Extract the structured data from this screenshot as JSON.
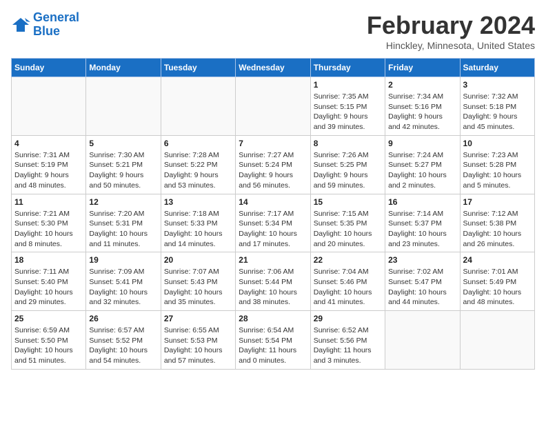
{
  "header": {
    "logo_line1": "General",
    "logo_line2": "Blue",
    "month": "February 2024",
    "location": "Hinckley, Minnesota, United States"
  },
  "weekdays": [
    "Sunday",
    "Monday",
    "Tuesday",
    "Wednesday",
    "Thursday",
    "Friday",
    "Saturday"
  ],
  "weeks": [
    [
      {
        "day": "",
        "info": ""
      },
      {
        "day": "",
        "info": ""
      },
      {
        "day": "",
        "info": ""
      },
      {
        "day": "",
        "info": ""
      },
      {
        "day": "1",
        "info": "Sunrise: 7:35 AM\nSunset: 5:15 PM\nDaylight: 9 hours\nand 39 minutes."
      },
      {
        "day": "2",
        "info": "Sunrise: 7:34 AM\nSunset: 5:16 PM\nDaylight: 9 hours\nand 42 minutes."
      },
      {
        "day": "3",
        "info": "Sunrise: 7:32 AM\nSunset: 5:18 PM\nDaylight: 9 hours\nand 45 minutes."
      }
    ],
    [
      {
        "day": "4",
        "info": "Sunrise: 7:31 AM\nSunset: 5:19 PM\nDaylight: 9 hours\nand 48 minutes."
      },
      {
        "day": "5",
        "info": "Sunrise: 7:30 AM\nSunset: 5:21 PM\nDaylight: 9 hours\nand 50 minutes."
      },
      {
        "day": "6",
        "info": "Sunrise: 7:28 AM\nSunset: 5:22 PM\nDaylight: 9 hours\nand 53 minutes."
      },
      {
        "day": "7",
        "info": "Sunrise: 7:27 AM\nSunset: 5:24 PM\nDaylight: 9 hours\nand 56 minutes."
      },
      {
        "day": "8",
        "info": "Sunrise: 7:26 AM\nSunset: 5:25 PM\nDaylight: 9 hours\nand 59 minutes."
      },
      {
        "day": "9",
        "info": "Sunrise: 7:24 AM\nSunset: 5:27 PM\nDaylight: 10 hours\nand 2 minutes."
      },
      {
        "day": "10",
        "info": "Sunrise: 7:23 AM\nSunset: 5:28 PM\nDaylight: 10 hours\nand 5 minutes."
      }
    ],
    [
      {
        "day": "11",
        "info": "Sunrise: 7:21 AM\nSunset: 5:30 PM\nDaylight: 10 hours\nand 8 minutes."
      },
      {
        "day": "12",
        "info": "Sunrise: 7:20 AM\nSunset: 5:31 PM\nDaylight: 10 hours\nand 11 minutes."
      },
      {
        "day": "13",
        "info": "Sunrise: 7:18 AM\nSunset: 5:33 PM\nDaylight: 10 hours\nand 14 minutes."
      },
      {
        "day": "14",
        "info": "Sunrise: 7:17 AM\nSunset: 5:34 PM\nDaylight: 10 hours\nand 17 minutes."
      },
      {
        "day": "15",
        "info": "Sunrise: 7:15 AM\nSunset: 5:35 PM\nDaylight: 10 hours\nand 20 minutes."
      },
      {
        "day": "16",
        "info": "Sunrise: 7:14 AM\nSunset: 5:37 PM\nDaylight: 10 hours\nand 23 minutes."
      },
      {
        "day": "17",
        "info": "Sunrise: 7:12 AM\nSunset: 5:38 PM\nDaylight: 10 hours\nand 26 minutes."
      }
    ],
    [
      {
        "day": "18",
        "info": "Sunrise: 7:11 AM\nSunset: 5:40 PM\nDaylight: 10 hours\nand 29 minutes."
      },
      {
        "day": "19",
        "info": "Sunrise: 7:09 AM\nSunset: 5:41 PM\nDaylight: 10 hours\nand 32 minutes."
      },
      {
        "day": "20",
        "info": "Sunrise: 7:07 AM\nSunset: 5:43 PM\nDaylight: 10 hours\nand 35 minutes."
      },
      {
        "day": "21",
        "info": "Sunrise: 7:06 AM\nSunset: 5:44 PM\nDaylight: 10 hours\nand 38 minutes."
      },
      {
        "day": "22",
        "info": "Sunrise: 7:04 AM\nSunset: 5:46 PM\nDaylight: 10 hours\nand 41 minutes."
      },
      {
        "day": "23",
        "info": "Sunrise: 7:02 AM\nSunset: 5:47 PM\nDaylight: 10 hours\nand 44 minutes."
      },
      {
        "day": "24",
        "info": "Sunrise: 7:01 AM\nSunset: 5:49 PM\nDaylight: 10 hours\nand 48 minutes."
      }
    ],
    [
      {
        "day": "25",
        "info": "Sunrise: 6:59 AM\nSunset: 5:50 PM\nDaylight: 10 hours\nand 51 minutes."
      },
      {
        "day": "26",
        "info": "Sunrise: 6:57 AM\nSunset: 5:52 PM\nDaylight: 10 hours\nand 54 minutes."
      },
      {
        "day": "27",
        "info": "Sunrise: 6:55 AM\nSunset: 5:53 PM\nDaylight: 10 hours\nand 57 minutes."
      },
      {
        "day": "28",
        "info": "Sunrise: 6:54 AM\nSunset: 5:54 PM\nDaylight: 11 hours\nand 0 minutes."
      },
      {
        "day": "29",
        "info": "Sunrise: 6:52 AM\nSunset: 5:56 PM\nDaylight: 11 hours\nand 3 minutes."
      },
      {
        "day": "",
        "info": ""
      },
      {
        "day": "",
        "info": ""
      }
    ]
  ]
}
